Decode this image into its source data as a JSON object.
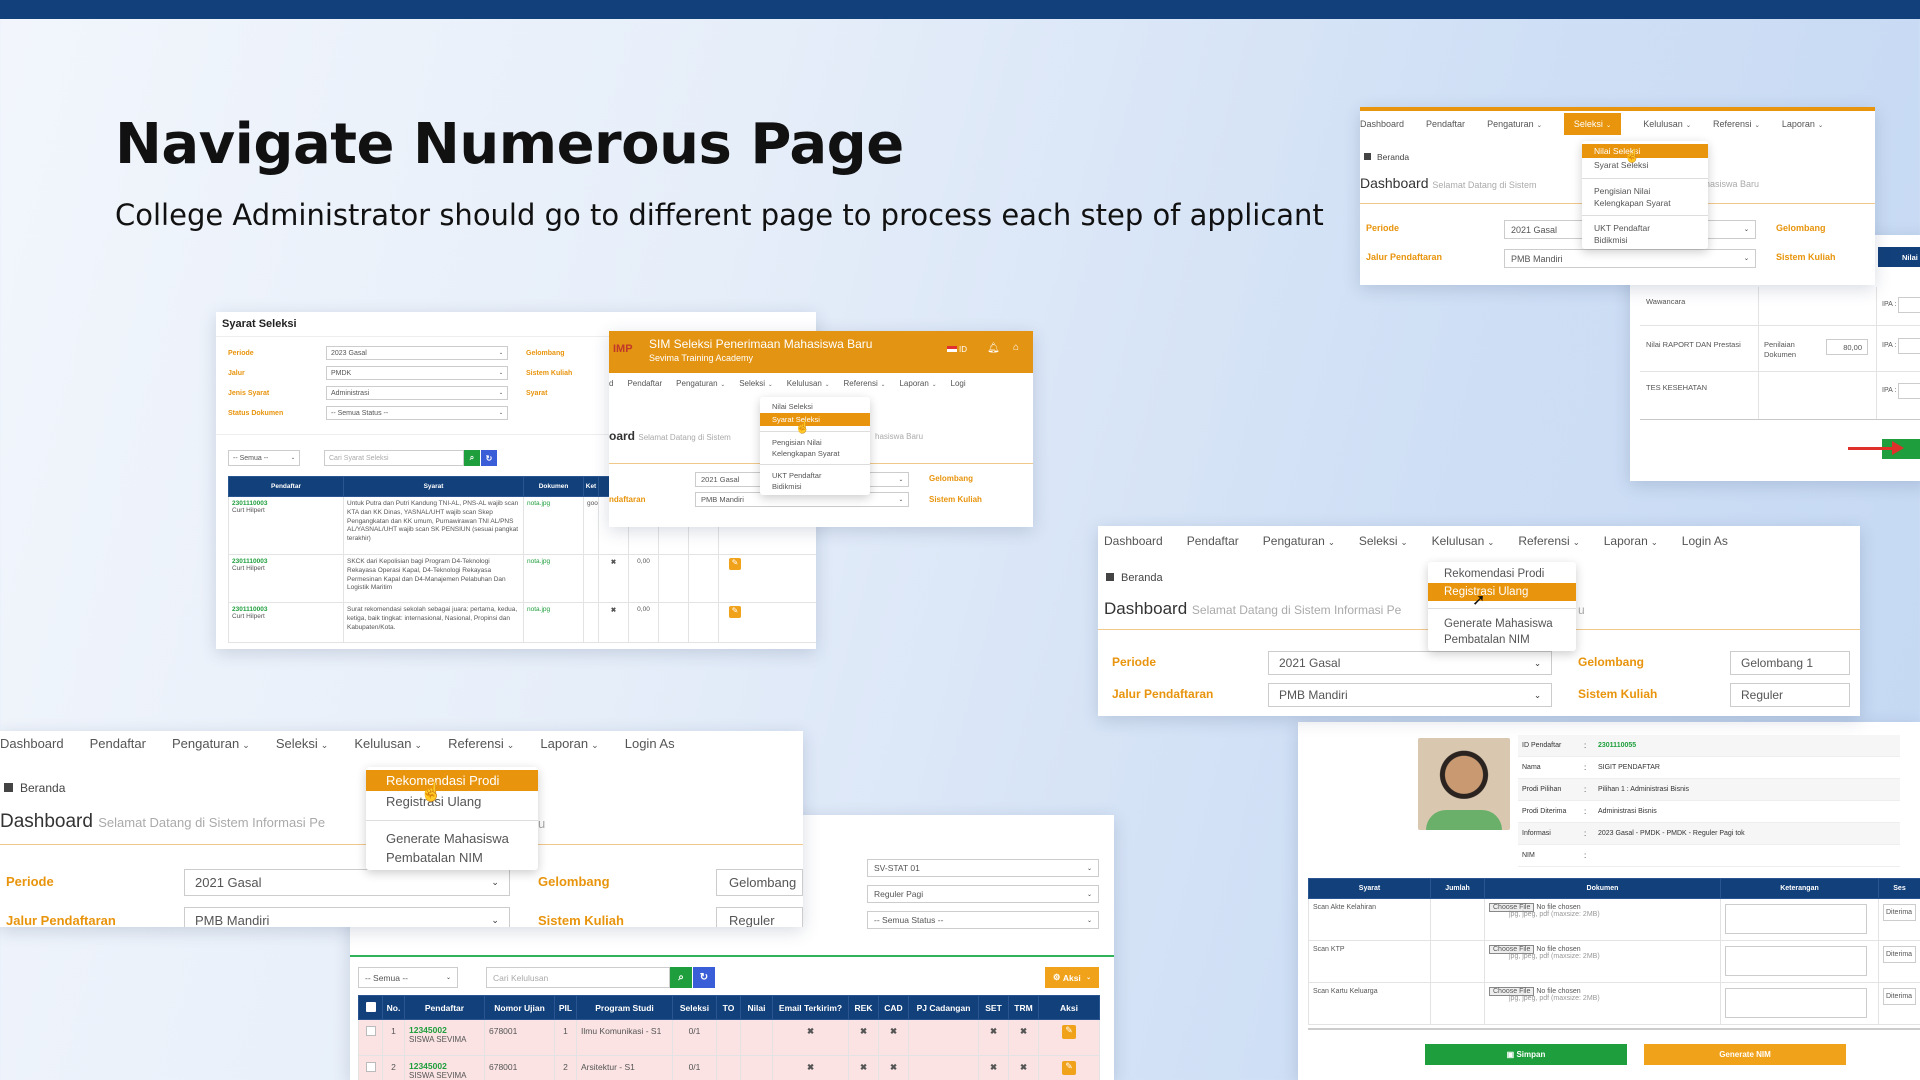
{
  "headline": {
    "title": "Navigate Numerous Page",
    "subtitle": "College Administrator should go to different page to process each step of applicant"
  },
  "colors": {
    "navy": "#12407a",
    "orange": "#e8940c",
    "green": "#1e9e3c",
    "red": "#e0302a"
  },
  "syarat": {
    "title": "Syarat Seleksi",
    "labels": [
      "Periode",
      "Jalur",
      "Jenis Syarat",
      "Status Dokumen"
    ],
    "values": [
      "2023 Gasal",
      "PMDK",
      "Administrasi",
      "-- Semua Status --"
    ],
    "right_labels": [
      "Gelombang",
      "Sistem Kuliah",
      "Syarat"
    ],
    "filter_all": "-- Semua --",
    "search_placeholder": "Cari Syarat Seleksi",
    "headers": [
      "Pendaftar",
      "Syarat",
      "Dokumen",
      "Ket"
    ],
    "rows": [
      {
        "id": "2301110003",
        "name": "Curt Hilpert",
        "syarat": "Untuk Putra dan Putri Kandung TNI-AL, PNS-AL wajib scan KTA dan KK Dinas, YASNAL/UHT wajib scan Skep Pengangkatan dan KK umum, Purnawirawan TNI AL/PNS AL/YASNAL/UHT wajib scan SK PENSIUN (sesuai pangkat terakhir)",
        "dok": "nota.jpg",
        "ket": "goo",
        "x": "",
        "val": ""
      },
      {
        "id": "2301110003",
        "name": "Curt Hilpert",
        "syarat": "SKCK dari Kepolisian bagi Program D4-Teknologi Rekayasa Operasi Kapal, D4-Teknologi Rekayasa Permesinan Kapal dan D4-Manajemen Pelabuhan Dan Logistik Maritim",
        "dok": "nota.jpg",
        "ket": "",
        "x": "✖",
        "val": "0,00"
      },
      {
        "id": "2301110003",
        "name": "Curt Hilpert",
        "syarat": "Surat rekomendasi sekolah sebagai juara: pertama, kedua, ketiga, baik tingkat: internasional, Nasional, Propinsi dan Kabupaten/Kota.",
        "dok": "nota.jpg",
        "ket": "",
        "x": "✖",
        "val": "0,00"
      }
    ]
  },
  "sim": {
    "logo": "IMP",
    "title": "SIM Seleksi Penerimaan Mahasiswa Baru",
    "subtitle": "Sevima Training Academy",
    "lang": "ID",
    "nav": [
      "d",
      "Pendaftar",
      "Pengaturan",
      "Seleksi",
      "Kelulusan",
      "Referensi",
      "Laporan",
      "Logi"
    ],
    "menu": [
      "Nilai Seleksi",
      "Syarat Seleksi",
      "Pengisian Nilai",
      "Kelengkapan Syarat",
      "UKT Pendaftar",
      "Bidikmisi"
    ],
    "dash_title": "oard",
    "dash_sub": "Selamat Datang di Sistem",
    "dash_sub_right": "hasiswa Baru",
    "periode": "2021 Gasal",
    "jalur_label": "ndaftaran",
    "jalur": "PMB Mandiri",
    "gel_label": "Gelombang",
    "sis_label": "Sistem Kuliah"
  },
  "topright": {
    "nav": [
      "Dashboard",
      "Pendaftar",
      "Pengaturan",
      "Seleksi",
      "Kelulusan",
      "Referensi",
      "Laporan"
    ],
    "menu": [
      "Nilai Seleksi",
      "Syarat Seleksi",
      "Pengisian Nilai",
      "Kelengkapan Syarat",
      "UKT Pendaftar",
      "Bidikmisi"
    ],
    "beranda": "Beranda",
    "dash_title": "Dashboard",
    "dash_sub": "Selamat Datang di Sistem",
    "dash_sub_right": "ahasiswa Baru",
    "periode_label": "Periode",
    "periode": "2021 Gasal",
    "jalur_label": "Jalur Pendaftaran",
    "jalur": "PMB Mandiri",
    "gel_label": "Gelombang",
    "sis_label": "Sistem Kuliah"
  },
  "nilai": {
    "col": "Nilai",
    "rows": [
      "Wawancara",
      "Nilai RAPORT DAN Prestasi",
      "TES KESEHATAN"
    ],
    "penilaian": "Penilaian Dokumen",
    "penilaian_value": "80,00",
    "ipa": "IPA :"
  },
  "kelulusan": {
    "nav": [
      "Dashboard",
      "Pendaftar",
      "Pengaturan",
      "Seleksi",
      "Kelulusan",
      "Referensi",
      "Laporan",
      "Login As"
    ],
    "menu": [
      "Rekomendasi Prodi",
      "Registrasi Ulang",
      "Generate Mahasiswa",
      "Pembatalan NIM"
    ],
    "beranda": "Beranda",
    "dash_title": "Dashboard",
    "dash_sub": "Selamat Datang di Sistem Informasi Pe",
    "dash_sub_right": "u",
    "periode_label": "Periode",
    "periode": "2021 Gasal",
    "jalur_label": "Jalur Pendaftaran",
    "jalur": "PMB Mandiri",
    "gel_label": "Gelombang",
    "gel": "Gelombang 1",
    "sis_label": "Sistem Kuliah",
    "sis": "Reguler"
  },
  "rekom": {
    "nav": [
      "Dashboard",
      "Pendaftar",
      "Pengaturan",
      "Seleksi",
      "Kelulusan",
      "Referensi",
      "Laporan",
      "Login As"
    ],
    "menu": [
      "Rekomendasi Prodi",
      "Registrasi Ulang",
      "Generate Mahasiswa",
      "Pembatalan NIM"
    ],
    "beranda": "Beranda",
    "dash_title": "Dashboard",
    "dash_sub": "Selamat Datang di Sistem Informasi Pe",
    "dash_sub_right": "u",
    "periode_label": "Periode",
    "periode": "2021 Gasal",
    "jalur_label": "Jalur Pendaftaran",
    "jalur": "PMB Mandiri",
    "gel_label": "Gelombang",
    "gel": "Gelombang",
    "sis_label": "Sistem Kuliah",
    "sis": "Reguler"
  },
  "kelulusan_table": {
    "selects": [
      "SV-STAT 01",
      "Reguler Pagi",
      "-- Semua Status --"
    ],
    "filter_all": "-- Semua --",
    "search_placeholder": "Cari Kelulusan",
    "aksi": "Aksi",
    "headers": [
      "",
      "No.",
      "Pendaftar",
      "Nomor Ujian",
      "PIL",
      "Program Studi",
      "Seleksi",
      "TO",
      "Nilai",
      "Email Terkirim?",
      "REK",
      "CAD",
      "PJ Cadangan",
      "SET",
      "TRM",
      "Aksi"
    ],
    "rows": [
      {
        "no": "1",
        "id": "12345002",
        "name": "SISWA SEVIMA",
        "ujian": "678001",
        "pil": "1",
        "prodi": "Ilmu Komunikasi - S1",
        "seleksi": "0/1"
      },
      {
        "no": "2",
        "id": "12345002",
        "name": "SISWA SEVIMA",
        "ujian": "678001",
        "pil": "2",
        "prodi": "Arsitektur - S1",
        "seleksi": "0/1"
      }
    ]
  },
  "registrasi": {
    "fields": [
      {
        "k": "ID Pendaftar",
        "v": "2301110055"
      },
      {
        "k": "Nama",
        "v": "SIGIT PENDAFTAR"
      },
      {
        "k": "Prodi Pilihan",
        "v": "Pilihan 1 : Administrasi Bisnis"
      },
      {
        "k": "Prodi Diterima",
        "v": "Administrasi Bisnis"
      },
      {
        "k": "Informasi",
        "v": "2023 Gasal - PMDK - PMDK - Reguler Pagi tok"
      },
      {
        "k": "NIM",
        "v": ""
      }
    ],
    "headers": [
      "Syarat",
      "Jumlah",
      "Dokumen",
      "Keterangan",
      "Ses"
    ],
    "docs": [
      "Scan Akte Kelahiran",
      "Scan KTP",
      "Scan Kartu Keluarga"
    ],
    "choose": "Choose File",
    "nofile": "No file chosen",
    "hint": "jpg, jpeg, pdf (maxsize: 2MB)",
    "diterima": "Diterima",
    "simpan": "Simpan",
    "generate": "Generate NIM"
  }
}
